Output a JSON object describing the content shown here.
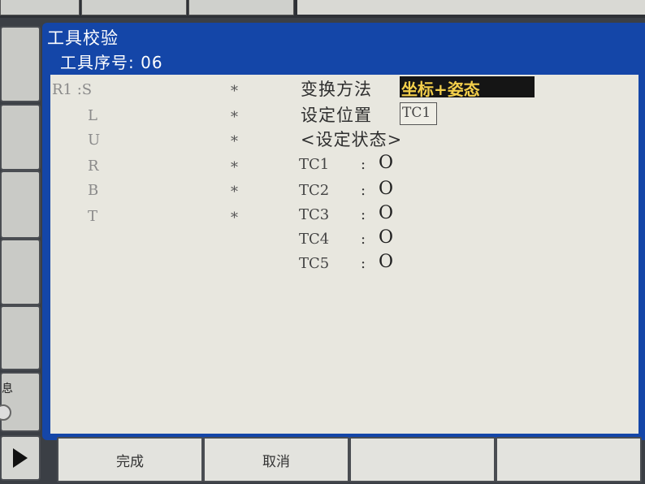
{
  "window": {
    "title": "工具校验",
    "tool_number_label": "工具序号: 06"
  },
  "axes": [
    {
      "label": "R1 :S",
      "value": "*"
    },
    {
      "label": "L",
      "value": "*"
    },
    {
      "label": "U",
      "value": "*"
    },
    {
      "label": "R",
      "value": "*"
    },
    {
      "label": "B",
      "value": "*"
    },
    {
      "label": "T",
      "value": "*"
    }
  ],
  "settings": {
    "conversion_method_label": "变换方法",
    "conversion_method_value": "坐标+姿态",
    "set_position_label": "设定位置",
    "set_position_value": "TC1",
    "set_status_label": "<设定状态>"
  },
  "status_rows": [
    {
      "label": "TC1",
      "sep": ":",
      "value": "O"
    },
    {
      "label": "TC2",
      "sep": ":",
      "value": "O"
    },
    {
      "label": "TC3",
      "sep": ":",
      "value": "O"
    },
    {
      "label": "TC4",
      "sep": ":",
      "value": "O"
    },
    {
      "label": "TC5",
      "sep": ":",
      "value": "O"
    }
  ],
  "function_keys": {
    "f1": "完成",
    "f2": "取消",
    "f3": "",
    "f4": ""
  },
  "side_keys": {
    "info_label": "息",
    "play_icon": "play-icon"
  },
  "colors": {
    "window_frame": "#1446a8",
    "content_bg": "#e8e7df",
    "selected_bg": "#151515",
    "selected_text": "#f3cf4b"
  }
}
